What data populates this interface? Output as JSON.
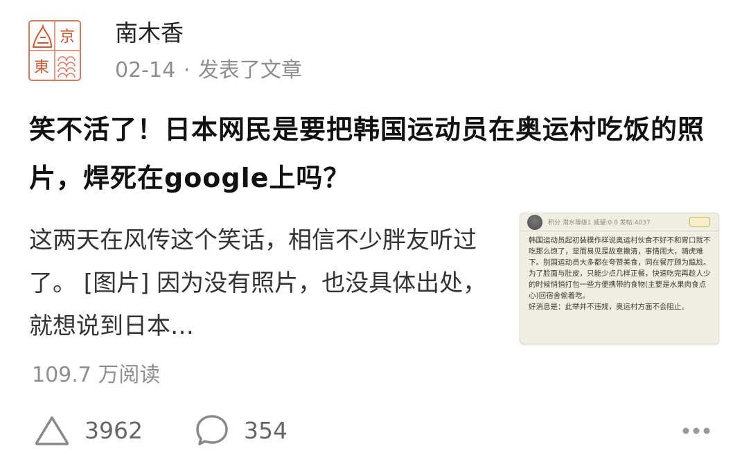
{
  "author": {
    "name": "南木香",
    "avatar_text": [
      "京",
      "東"
    ],
    "date": "02-14",
    "separator": "·",
    "action": "发表了文章"
  },
  "post": {
    "title": "笑不活了！日本网民是要把韩国运动员在奥运村吃饭的照片，焊死在google上吗？",
    "excerpt": "这两天在风传这个笑话，相信不少胖友听过了。 [图片] 因为没有照片，也没具体出处，就想说到日本…",
    "reads": "109.7 万阅读"
  },
  "thumbnail": {
    "meta": "积分  潜水等级1  威望:0.8  发帖:4037",
    "badge": "",
    "paragraphs": [
      "韩国运动员起初装模作样说奥运村伙食不好不和胃口就不吃那么饱了，显而易见是故意撇清，事情闹大，骑虎难下。别国运动员大多都在夸赞美食，同在餐厅顾为尴尬。",
      "为了脸面与肚皮，只能少点几样正餐，快速吃完再趁人少的时候悄悄打包一些方便携带的食物(主要是水果肉食点心)回宿舍偷着吃。",
      "好消息是：此举并不违规，奥运村方面不会阻止。"
    ]
  },
  "actions": {
    "likes": "3962",
    "comments": "354"
  },
  "icons": {
    "like": "triangle-like-icon",
    "comment": "speech-bubble-icon",
    "more": "more-dots-icon"
  },
  "colors": {
    "seal_red": "#d4572f",
    "meta_gray": "#8e8e8e",
    "thumb_bg": "#efeee2"
  }
}
